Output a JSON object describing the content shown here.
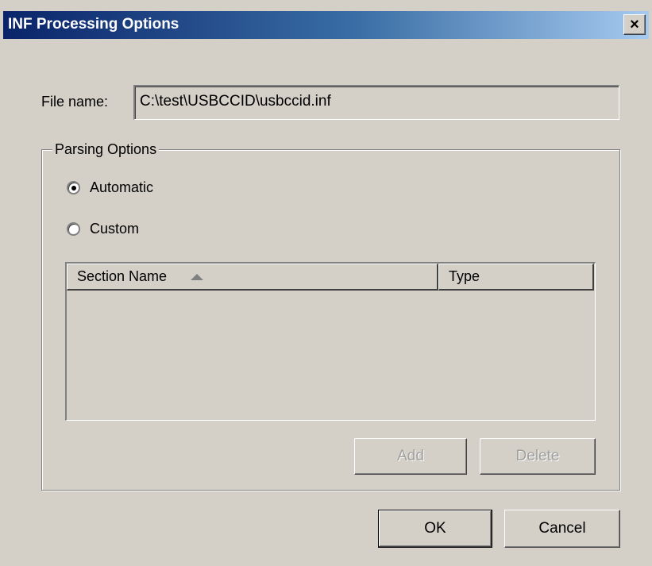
{
  "window": {
    "title": "INF Processing Options",
    "close_glyph": "×"
  },
  "file": {
    "label": "File name:",
    "value": "C:\\test\\USBCCID\\usbccid.inf"
  },
  "parsing": {
    "legend": "Parsing Options",
    "options": [
      {
        "label": "Automatic",
        "selected": true
      },
      {
        "label": "Custom",
        "selected": false
      }
    ],
    "list": {
      "columns": [
        "Section Name",
        "Type"
      ],
      "sort_column": "Section Name",
      "rows": []
    },
    "add_label": "Add",
    "delete_label": "Delete"
  },
  "footer": {
    "ok_label": "OK",
    "cancel_label": "Cancel"
  },
  "colors": {
    "title_gradient_start": "#0a246a",
    "title_gradient_end": "#a6caf0",
    "face": "#d4d0c8"
  },
  "icons": {
    "close": "close-icon",
    "sort": "sort-ascending-icon"
  }
}
